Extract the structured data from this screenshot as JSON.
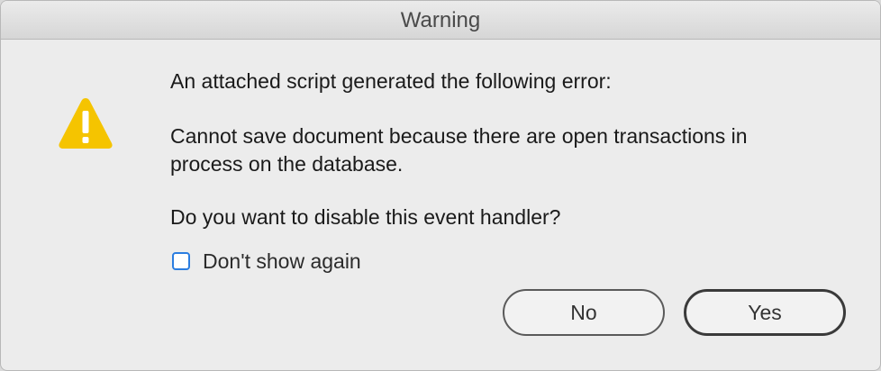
{
  "window": {
    "title": "Warning"
  },
  "icon": {
    "name": "warning-icon",
    "color": "#f5c400"
  },
  "message": {
    "intro": "An attached script generated the following error:",
    "error_line1": "Cannot save document because there are open transactions in",
    "error_line2": "process on the database.",
    "question": "Do you want to disable this event handler?"
  },
  "checkbox": {
    "label": "Don't show again",
    "checked": false
  },
  "buttons": {
    "no_label": "No",
    "yes_label": "Yes"
  }
}
